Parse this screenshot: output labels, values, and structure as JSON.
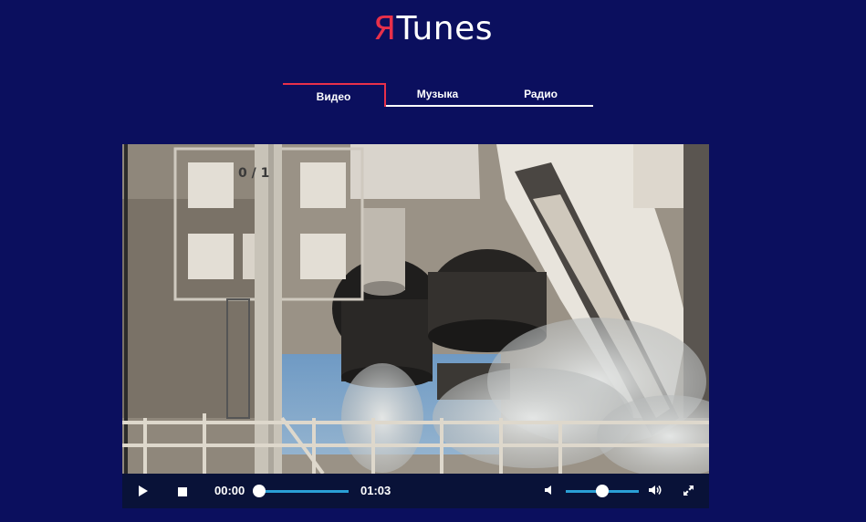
{
  "logo": {
    "accent": "Я",
    "rest": "Tunes",
    "accent_color": "#e8304a"
  },
  "tabs": [
    {
      "label": "Видео",
      "active": true
    },
    {
      "label": "Музыка",
      "active": false
    },
    {
      "label": "Радио",
      "active": false
    }
  ],
  "video": {
    "overlay_text": "0 / 1"
  },
  "player": {
    "current_time": "00:00",
    "total_time": "01:03",
    "progress": 0,
    "volume": 0.5,
    "icons": {
      "play": "play-icon",
      "stop": "stop-icon",
      "volume_low": "volume-low-icon",
      "volume_high": "volume-high-icon",
      "fullscreen": "fullscreen-icon"
    }
  },
  "colors": {
    "background": "#0b0f5e",
    "accent": "#e8304a",
    "progress": "#2a9fd6",
    "controls_bg": "#091238"
  }
}
